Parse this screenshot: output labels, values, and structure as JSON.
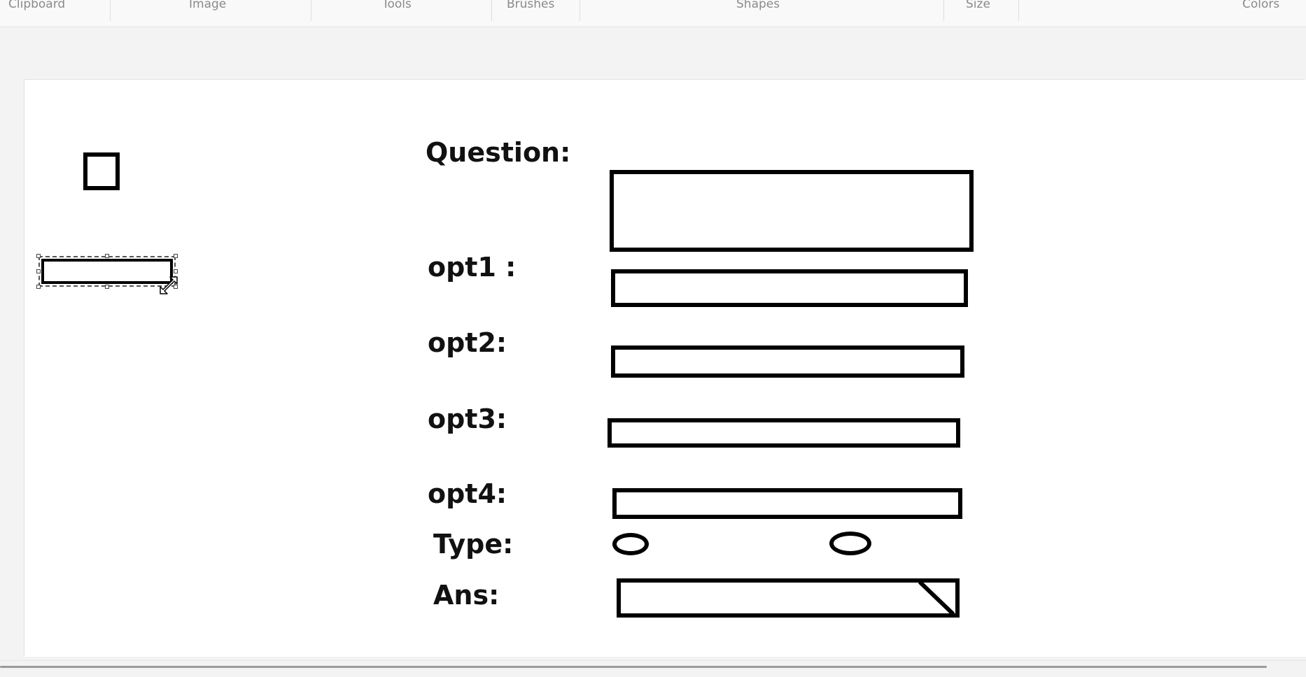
{
  "ribbon": {
    "groups": [
      {
        "label": "Clipboard"
      },
      {
        "label": "Image"
      },
      {
        "label": "Tools"
      },
      {
        "label": "Brushes"
      },
      {
        "label": "Shapes"
      },
      {
        "label": "Size"
      },
      {
        "label": "Colors"
      }
    ]
  },
  "canvas": {
    "labels": {
      "question": "Question:",
      "opt1": "opt1 :",
      "opt2": "opt2:",
      "opt3": "opt3:",
      "opt4": "opt4:",
      "type": "Type:",
      "ans": "Ans:"
    }
  },
  "colors": {
    "workspace_bg": "#f3f3f3",
    "canvas_bg": "#ffffff",
    "stroke": "#000000",
    "ribbon_text": "#8a8a8a"
  },
  "icons": {
    "resize": "diagonal-resize-cursor-icon",
    "dropdown_corner": "dropdown-triangle-icon"
  }
}
